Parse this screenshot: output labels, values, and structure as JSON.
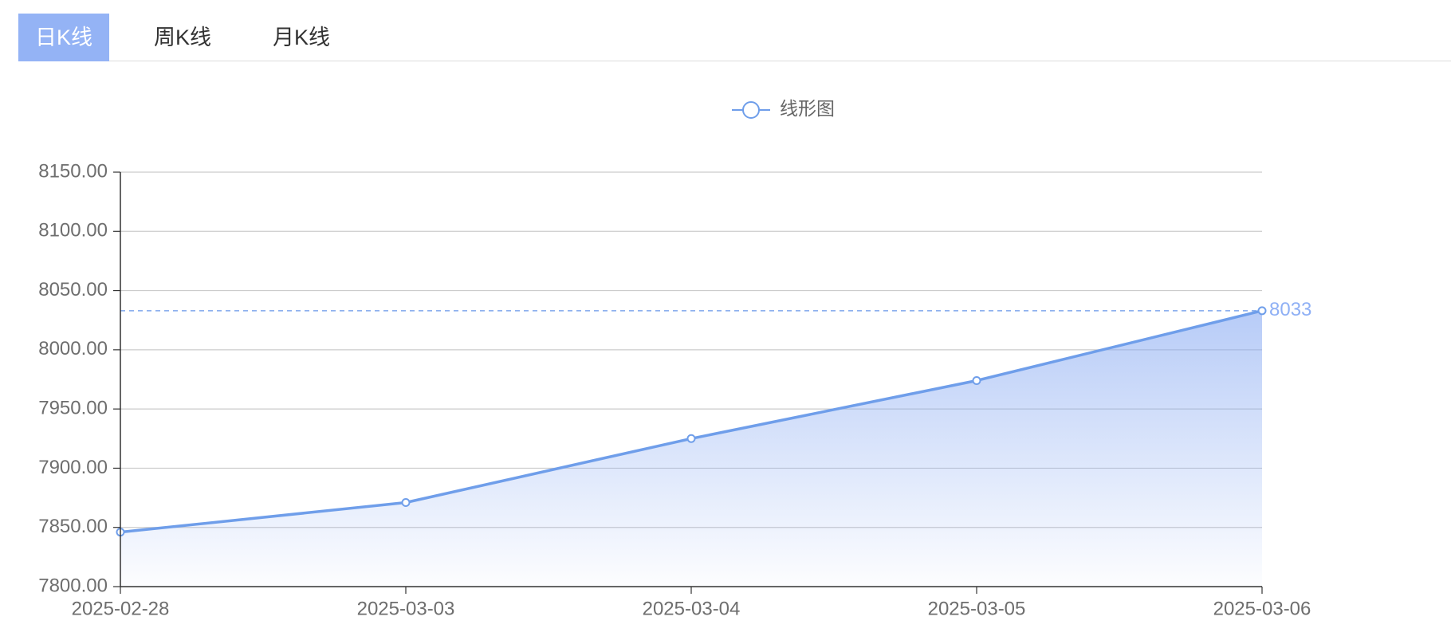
{
  "tabs": [
    {
      "label": "日K线",
      "active": true
    },
    {
      "label": "周K线",
      "active": false
    },
    {
      "label": "月K线",
      "active": false
    }
  ],
  "colors": {
    "accent": "#94b3f5",
    "line": "#6f9eea",
    "area": "#87a9f2",
    "markline": "#7ea6ec",
    "markline_label": "#8fb0f5",
    "grid": "#cccccc",
    "axis": "#333333"
  },
  "legend": {
    "icon": "line-circle-icon",
    "position": "top-center"
  },
  "chart_data": {
    "type": "area",
    "title": "",
    "xlabel": "",
    "ylabel": "",
    "categories": [
      "2025-02-28",
      "2025-03-03",
      "2025-03-04",
      "2025-03-05",
      "2025-03-06"
    ],
    "series": [
      {
        "name": "线形图",
        "values": [
          7846,
          7871,
          7925,
          7974,
          8033
        ]
      }
    ],
    "ylim": [
      7800,
      8150
    ],
    "yticks": [
      "8150.00",
      "8100.00",
      "8050.00",
      "8000.00",
      "7950.00",
      "7900.00",
      "7850.00",
      "7800.00"
    ],
    "grid": true,
    "legend_position": "top-center",
    "markline": {
      "value": 8033,
      "label": "8033",
      "style": "dashed"
    }
  }
}
